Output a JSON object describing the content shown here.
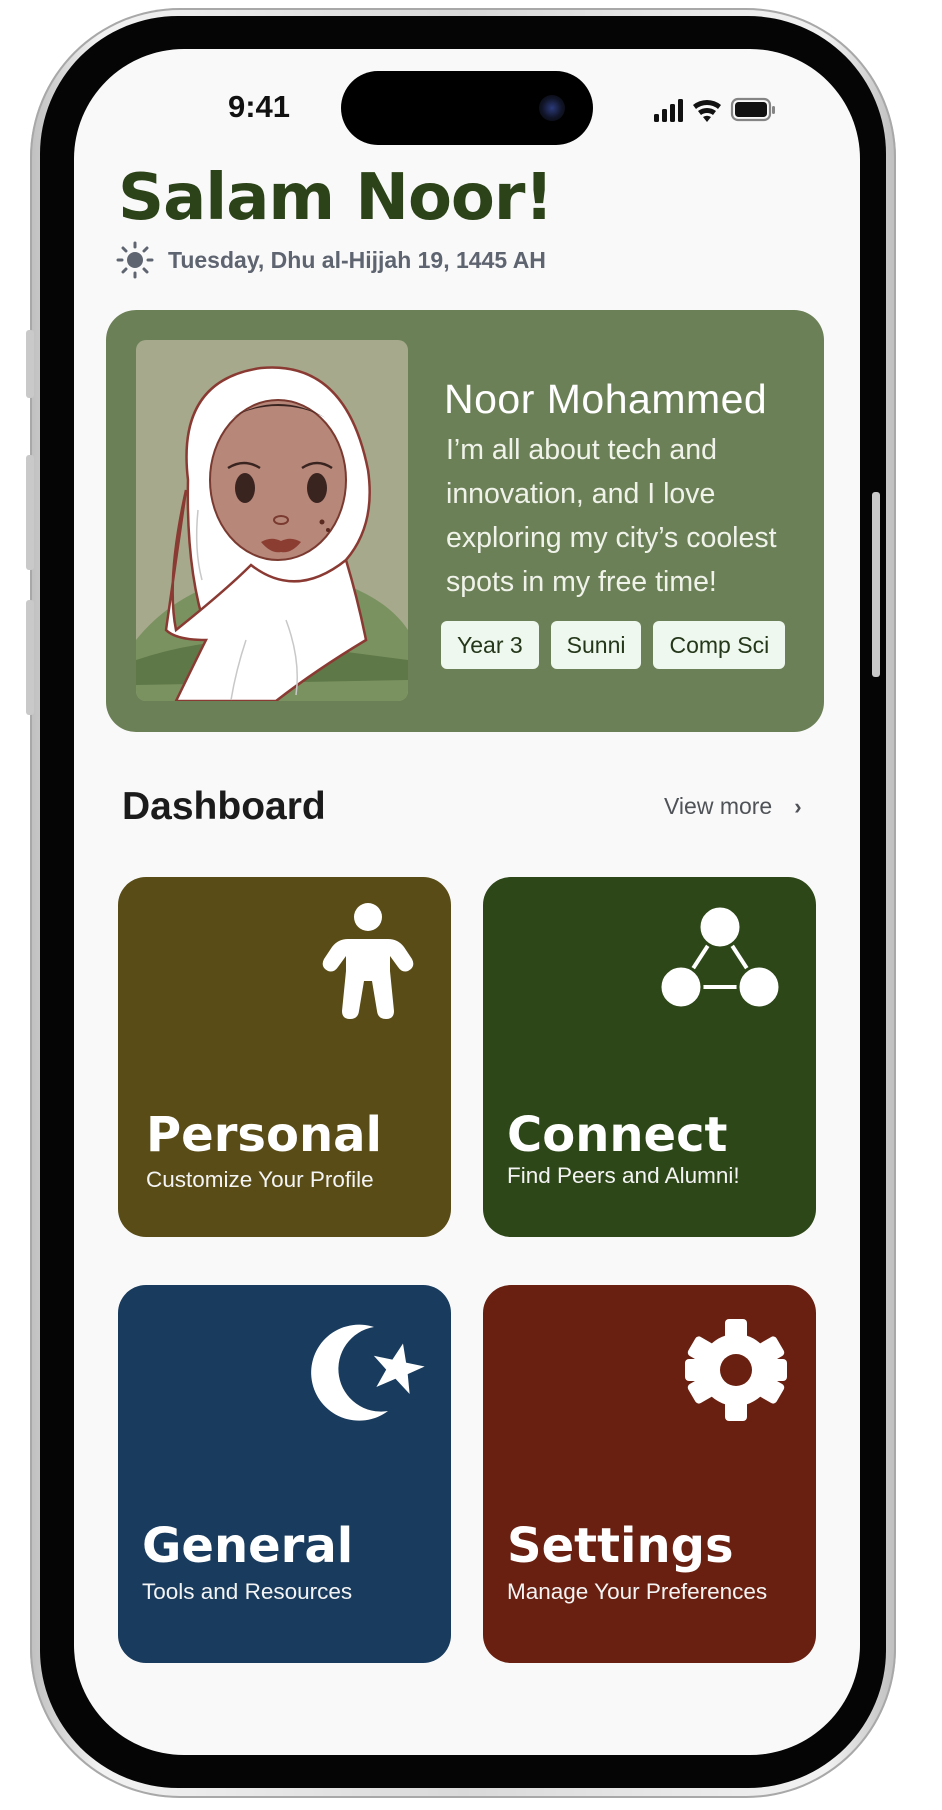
{
  "status_bar": {
    "time": "9:41"
  },
  "header": {
    "greeting": "Salam Noor!",
    "date": "Tuesday, Dhu al-Hijjah 19, 1445 AH",
    "date_icon": "sun-icon"
  },
  "profile": {
    "name": "Noor Mohammed",
    "bio": "I’m all about tech and innovation, and I love exploring my city’s coolest spots in my free time!",
    "tags": [
      "Year 3",
      "Sunni",
      "Comp Sci"
    ],
    "card_color": "#6c8057"
  },
  "dashboard": {
    "title": "Dashboard",
    "view_more": "View more",
    "view_more_icon": "chevron-right-icon",
    "tiles": [
      {
        "title": "Personal",
        "subtitle": "Customize Your Profile",
        "icon": "person-icon",
        "color": "#594c16"
      },
      {
        "title": "Connect",
        "subtitle": "Find Peers and Alumni!",
        "icon": "network-icon",
        "color": "#2d4718"
      },
      {
        "title": "General",
        "subtitle": "Tools and Resources",
        "icon": "crescent-star-icon",
        "color": "#183b5e"
      },
      {
        "title": "Settings",
        "subtitle": "Manage Your Preferences",
        "icon": "gear-icon",
        "color": "#6a2011"
      }
    ]
  }
}
